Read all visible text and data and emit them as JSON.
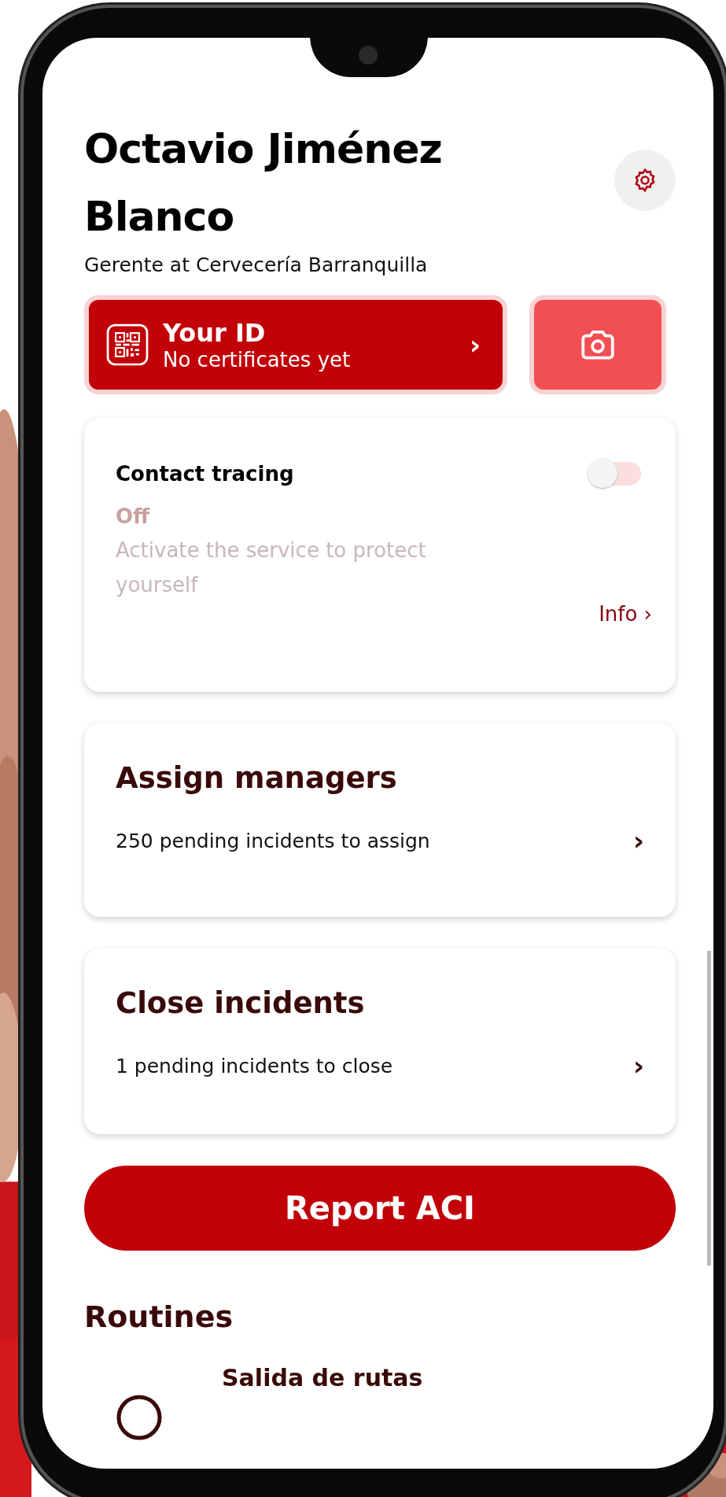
{
  "header": {
    "name": "Octavio Jiménez Blanco",
    "role": "Gerente at Cervecería Barranquilla"
  },
  "id_card": {
    "title": "Your ID",
    "subtitle": "No certificates yet",
    "arrow": "›"
  },
  "contact_tracing": {
    "title": "Contact tracing",
    "on": false,
    "status": "Off",
    "description": "Activate the service to protect yourself",
    "link": "Info ›"
  },
  "tasks": [
    {
      "title": "Assign managers",
      "subtitle": "250 pending incidents to assign",
      "arrow": "›"
    },
    {
      "title": "Close incidents",
      "subtitle": "1 pending incidents to close",
      "arrow": "›"
    }
  ],
  "report_button": "Report ACI",
  "routines": {
    "title": "Routines",
    "items": [
      {
        "title": "Salida de rutas"
      }
    ]
  }
}
